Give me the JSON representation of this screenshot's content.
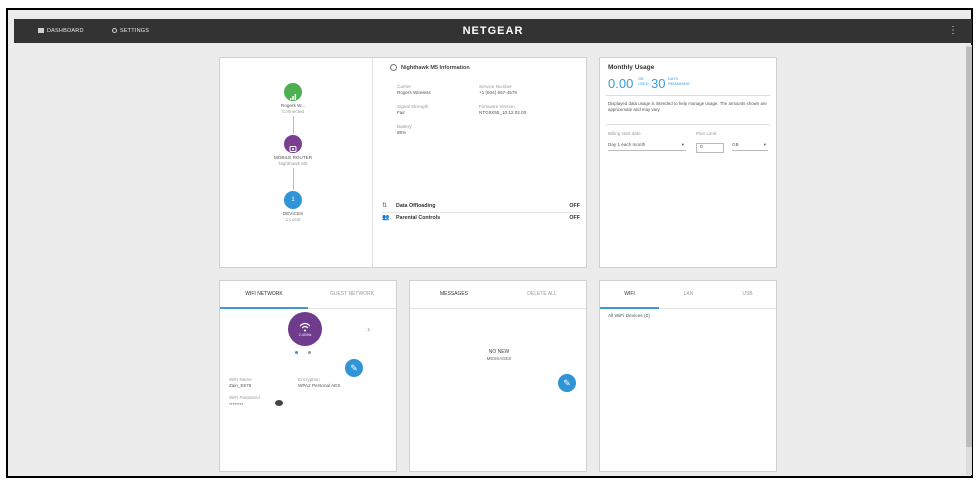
{
  "topbar": {
    "dashboard_label": "DASHBOARD",
    "settings_label": "SETTINGS",
    "brand": "NETGEAR",
    "menu_glyph": "⋮"
  },
  "device_flow": {
    "carrier_name": "Rogers W...",
    "carrier_status": "Connected",
    "router_name": "MOBILE ROUTER",
    "router_model": "Nighthawk M5",
    "devices_count": "1",
    "devices_label": "DEVICES",
    "devices_sub": "1 Local"
  },
  "info": {
    "title": "Nighthawk M5 Information",
    "carrier_label": "Carrier",
    "carrier_value": "Rogers Wireless",
    "service_label": "Service Number",
    "service_value": "+1 (604) 657-4576",
    "signal_label": "Signal Strength",
    "signal_value": "Fair",
    "firmware_label": "Firmware Version",
    "firmware_value": "NTG9X55_10.12.02.00",
    "battery_label": "Battery",
    "battery_value": "86%",
    "data_offloading_label": "Data Offloading",
    "data_offloading_value": "OFF",
    "parental_label": "Parental Controls",
    "parental_value": "OFF"
  },
  "usage": {
    "title": "Monthly Usage",
    "used_value": "0.00",
    "used_unit_top": "GB",
    "used_unit_bottom": "USED",
    "days_value": "30",
    "days_unit_top": "DAYS",
    "days_unit_bottom": "REMAINING",
    "note": "Displayed data usage is intended to help manage usage. The amounts shown are approximate and may vary.",
    "billing_label": "Billing start date",
    "billing_value": "Day 1 each month",
    "plan_label": "Plan Limit",
    "plan_value": "0",
    "plan_unit": "GB"
  },
  "wifi_card": {
    "tab_wifi": "WIFI NETWORK",
    "tab_guest": "GUEST NETWORK",
    "band": "2.4GHz",
    "name_label": "WiFi Name",
    "name_value": "Zain_E578",
    "encryption_label": "Encryption",
    "encryption_value": "WPA2 Personal AES",
    "password_label": "WiFi Password",
    "password_value": "********"
  },
  "messages_card": {
    "tab_messages": "MESSAGES",
    "tab_delete": "DELETE ALL",
    "empty_line1": "NO NEW",
    "empty_line2": "MESSAGES"
  },
  "devices_card": {
    "tab_wifi": "WIFI",
    "tab_lan": "LAN",
    "tab_usb": "USB",
    "all_devices": "All WiFi Devices (0)"
  },
  "colors": {
    "accent": "#3a9bd8",
    "carrier_green": "#4caf50",
    "router_purple": "#7b3f91",
    "topbar": "#333333"
  }
}
